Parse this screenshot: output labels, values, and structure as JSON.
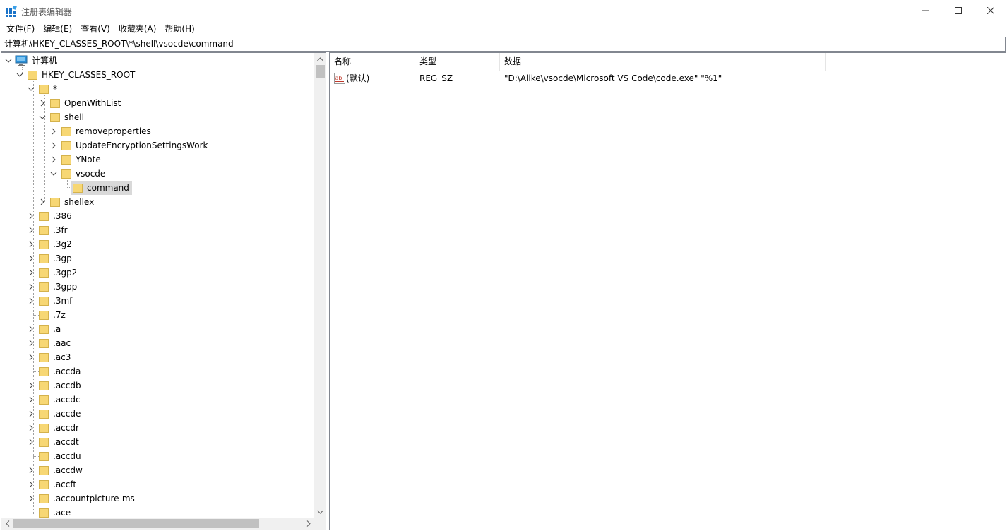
{
  "window": {
    "title": "注册表编辑器",
    "icon": "regedit-icon"
  },
  "menu": [
    "文件(F)",
    "编辑(E)",
    "查看(V)",
    "收藏夹(A)",
    "帮助(H)"
  ],
  "address": "计算机\\HKEY_CLASSES_ROOT\\*\\shell\\vsocde\\command",
  "tree": {
    "root": "计算机",
    "hive": "HKEY_CLASSES_ROOT",
    "star": "*",
    "openwithlist": "OpenWithList",
    "shell": "shell",
    "removeproperties": "removeproperties",
    "updateencryption": "UpdateEncryptionSettingsWork",
    "ynote": "YNote",
    "vsocde": "vsocde",
    "command": "command",
    "shellex": "shellex",
    "extensions": [
      ".386",
      ".3fr",
      ".3g2",
      ".3gp",
      ".3gp2",
      ".3gpp",
      ".3mf",
      ".7z",
      ".a",
      ".aac",
      ".ac3",
      ".accda",
      ".accdb",
      ".accdc",
      ".accde",
      ".accdr",
      ".accdt",
      ".accdu",
      ".accdw",
      ".accft",
      ".accountpicture-ms",
      ".ace"
    ]
  },
  "columns": {
    "name": "名称",
    "type": "类型",
    "data": "数据"
  },
  "values": [
    {
      "name": "(默认)",
      "type": "REG_SZ",
      "data": "\"D:\\Alike\\vsocde\\Microsoft VS Code\\code.exe\" \"%1\""
    }
  ],
  "colors": {
    "folder": "#f7d774",
    "selection": "#d9d9d9",
    "border": "#828790"
  }
}
